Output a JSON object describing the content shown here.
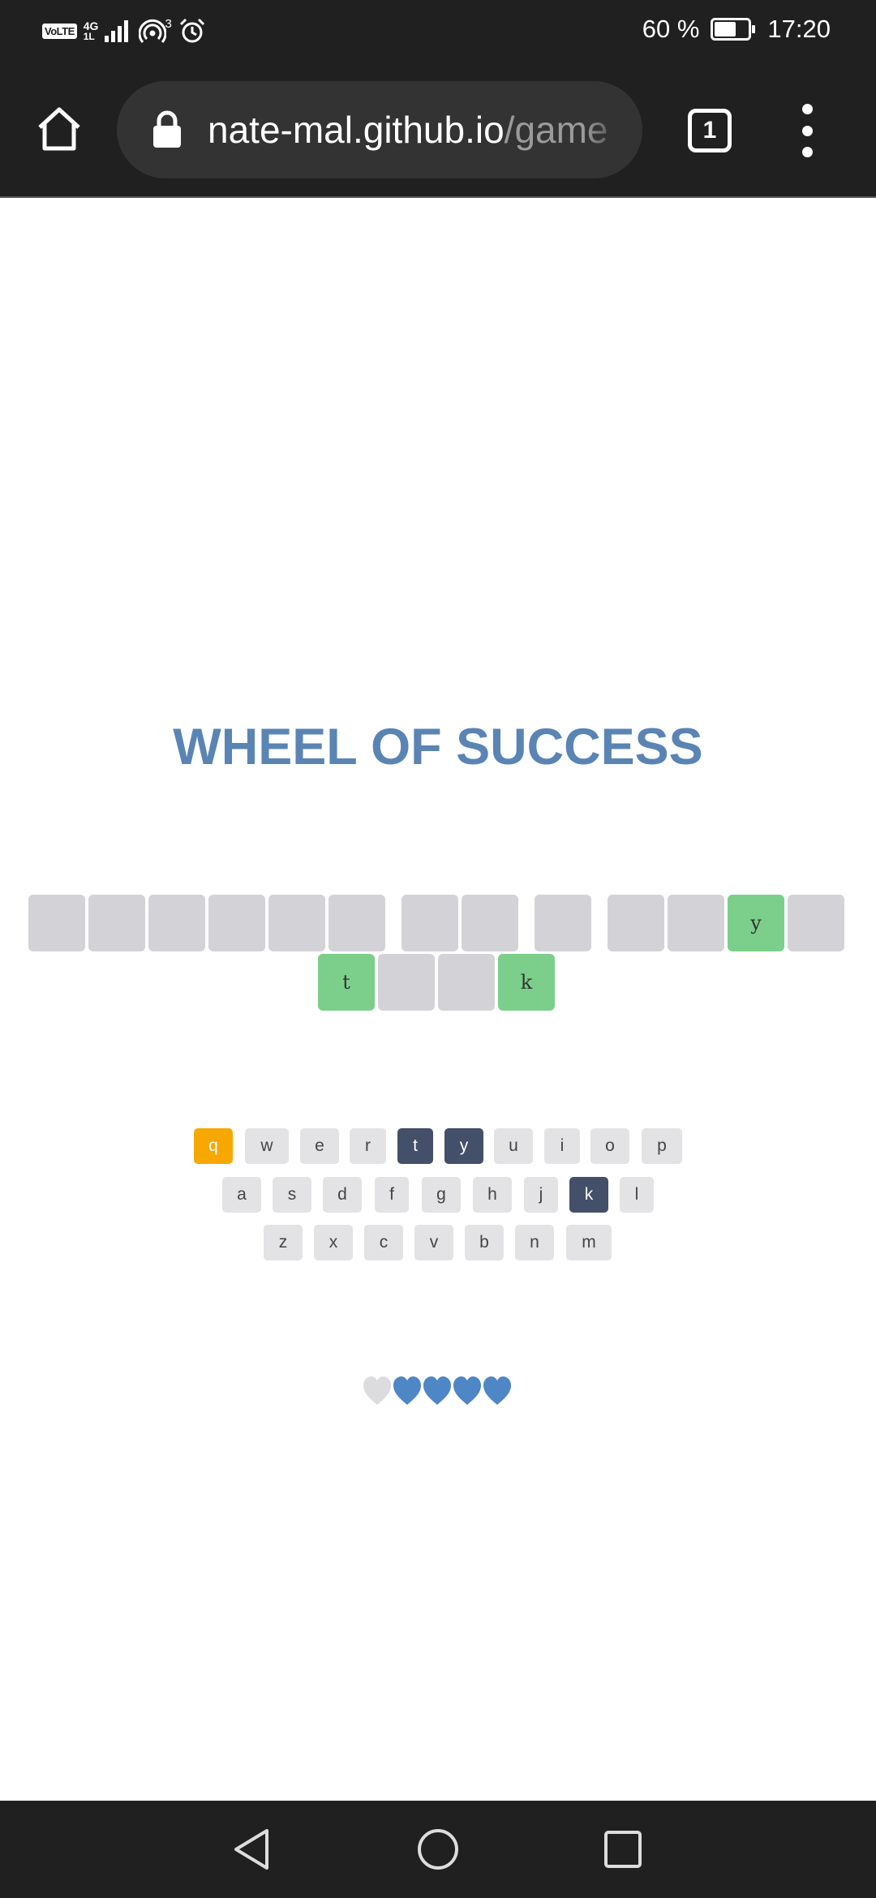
{
  "status_bar": {
    "volte": "VoLTE",
    "network": "4G",
    "network_sub": "1L",
    "hotspot_count": "3",
    "battery": "60 %",
    "time": "17:20"
  },
  "browser": {
    "url_domain": "nate-mal.github.io",
    "url_path": "/game",
    "tab_count": "1"
  },
  "game": {
    "title": "WHEEL OF SUCCESS",
    "tiles": [
      "",
      "",
      "",
      "",
      "",
      "",
      "",
      "",
      "",
      "",
      "",
      "y",
      "",
      "t",
      "",
      "",
      "k"
    ],
    "keyboard": {
      "row1": [
        "q",
        "w",
        "e",
        "r",
        "t",
        "y",
        "u",
        "i",
        "o",
        "p"
      ],
      "row2": [
        "a",
        "s",
        "d",
        "f",
        "g",
        "h",
        "j",
        "k",
        "l"
      ],
      "row3": [
        "z",
        "x",
        "c",
        "v",
        "b",
        "n",
        "m"
      ]
    },
    "guessed_correct": [
      "t",
      "y",
      "k"
    ],
    "guessed_wrong": [
      "q"
    ],
    "lives": {
      "total": 5,
      "remaining": 4
    },
    "colors": {
      "title": "#5a84b4",
      "tile_hidden": "#d3d3d7",
      "tile_revealed": "#7ccf8a",
      "key_default": "#e3e3e5",
      "key_correct": "#444f69",
      "key_wrong": "#f6a800",
      "heart_full": "#4f86c6",
      "heart_empty": "#dcdcdf"
    }
  }
}
